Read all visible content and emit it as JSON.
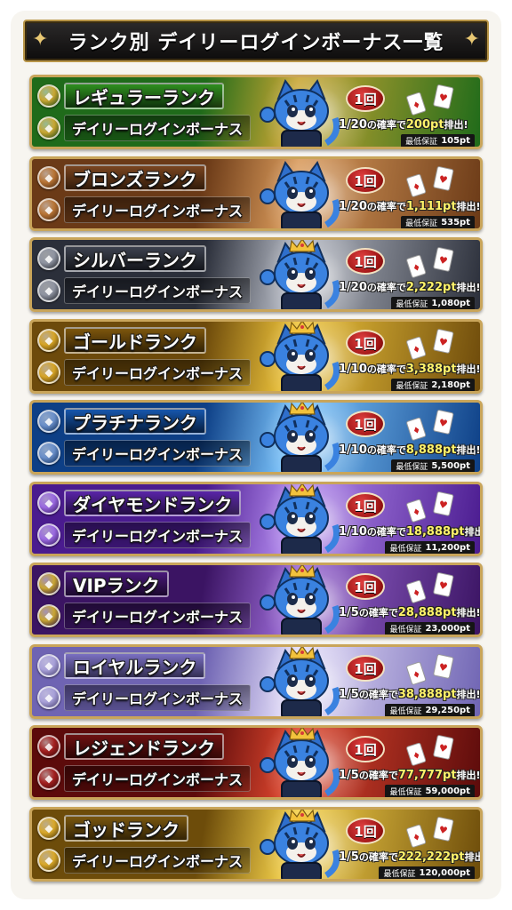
{
  "header": {
    "title": "ランク別 デイリーログインボーナス一覧"
  },
  "daily_label": "デイリーログインボーナス",
  "count_label": "1回",
  "guarantee_label": "最低保証",
  "rate_mid": "の確率で",
  "rate_suffix": "排出!",
  "ranks": [
    {
      "name": "レギュラーランク",
      "odds": "1/20",
      "points": "200pt",
      "guarantee": "105pt",
      "bg": "#1f6b1a",
      "bg2": "#c9a633",
      "coin": "#c9a633",
      "plate": "#2f8f1f",
      "crown": false
    },
    {
      "name": "ブロンズランク",
      "odds": "1/20",
      "points": "1,111pt",
      "guarantee": "535pt",
      "bg": "#6b3a17",
      "bg2": "#d99a5b",
      "coin": "#b87435",
      "plate": "#7a4520",
      "crown": false
    },
    {
      "name": "シルバーランク",
      "odds": "1/20",
      "points": "2,222pt",
      "guarantee": "1,080pt",
      "bg": "#2b2f3a",
      "bg2": "#b8bcc6",
      "coin": "#8f94a1",
      "plate": "#3d424f",
      "crown": true
    },
    {
      "name": "ゴールドランク",
      "odds": "1/10",
      "points": "3,388pt",
      "guarantee": "2,180pt",
      "bg": "#6d4a0b",
      "bg2": "#f0c63c",
      "coin": "#d6a426",
      "plate": "#7d560d",
      "crown": true
    },
    {
      "name": "プラチナランク",
      "odds": "1/10",
      "points": "8,888pt",
      "guarantee": "5,500pt",
      "bg": "#0d3f86",
      "bg2": "#7fc8ff",
      "coin": "#6a8fc9",
      "plate": "#1757ad",
      "crown": true
    },
    {
      "name": "ダイヤモンドランク",
      "odds": "1/10",
      "points": "18,888pt",
      "guarantee": "11,200pt",
      "bg": "#4a1b8f",
      "bg2": "#b58cf0",
      "coin": "#9a6ae0",
      "plate": "#5a25a8",
      "crown": true
    },
    {
      "name": "VIPランク",
      "odds": "1/5",
      "points": "28,888pt",
      "guarantee": "23,000pt",
      "bg": "#3b1463",
      "bg2": "#9b6ad6",
      "coin": "#c9a633",
      "plate": "#4a1a7a",
      "crown": true
    },
    {
      "name": "ロイヤルランク",
      "odds": "1/5",
      "points": "38,888pt",
      "guarantee": "29,250pt",
      "bg": "#6f64b3",
      "bg2": "#e6e0fa",
      "coin": "#a8a0d8",
      "plate": "#7a6fc2",
      "crown": true
    },
    {
      "name": "レジェンドランク",
      "odds": "1/5",
      "points": "77,777pt",
      "guarantee": "59,000pt",
      "bg": "#5c0b0b",
      "bg2": "#e0472e",
      "coin": "#a32020",
      "plate": "#6e1212",
      "crown": true
    },
    {
      "name": "ゴッドランク",
      "odds": "1/5",
      "points": "222,222pt",
      "guarantee": "120,000pt",
      "bg": "#6d4c0a",
      "bg2": "#f6d24a",
      "coin": "#d9a82a",
      "plate": "#7a5710",
      "crown": true
    }
  ]
}
